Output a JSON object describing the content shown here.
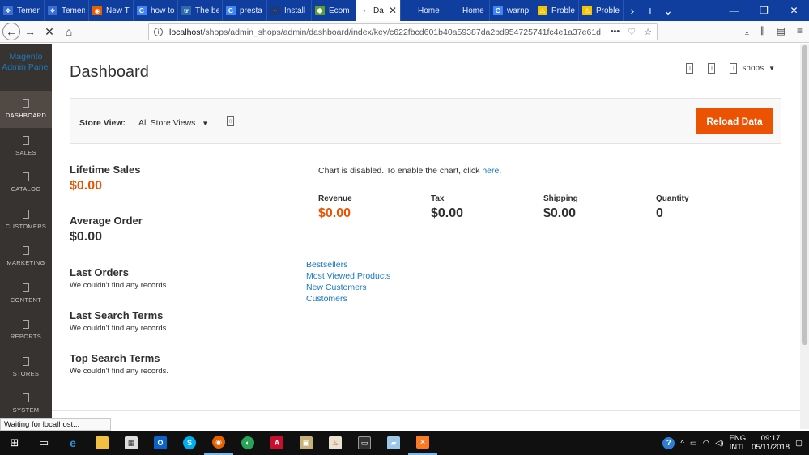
{
  "browser": {
    "tabs": [
      {
        "label": "Temen",
        "favicon_color": "#3b6fd1",
        "glyph": "❖"
      },
      {
        "label": "Temen",
        "favicon_color": "#3b6fd1",
        "glyph": "❖"
      },
      {
        "label": "New T",
        "favicon_color": "#e66000",
        "glyph": "◉"
      },
      {
        "label": "how to",
        "favicon_color": "#4285f4",
        "glyph": "G"
      },
      {
        "label": "The be",
        "favicon_color": "#2f6aa8",
        "glyph": "tr"
      },
      {
        "label": "presta",
        "favicon_color": "#4285f4",
        "glyph": "G"
      },
      {
        "label": "Install",
        "favicon_color": "#1b3b7a",
        "glyph": "~"
      },
      {
        "label": "Ecom",
        "favicon_color": "#5aa02c",
        "glyph": "⬢"
      },
      {
        "label": "Da",
        "favicon_color": "#ffffff",
        "glyph": "•",
        "active": true
      },
      {
        "label": "Home page",
        "favicon_color": "#0f3e9f",
        "glyph": ""
      },
      {
        "label": "Home page",
        "favicon_color": "#0f3e9f",
        "glyph": ""
      },
      {
        "label": "warnp",
        "favicon_color": "#4285f4",
        "glyph": "G"
      },
      {
        "label": "Proble",
        "favicon_color": "#f5c400",
        "glyph": "⚠"
      },
      {
        "label": "Proble",
        "favicon_color": "#f5c400",
        "glyph": "⚠"
      }
    ],
    "url_host": "localhost",
    "url_path": "/shops/admin_shops/admin/dashboard/index/key/c622fbcd601b40a59387da2bd954725741fc4e1a37e61d",
    "status_text": "Waiting for localhost..."
  },
  "sidebar": {
    "logo_line1": "Magento",
    "logo_line2": "Admin Panel",
    "items": [
      {
        "label": "DASHBOARD",
        "active": true
      },
      {
        "label": "SALES"
      },
      {
        "label": "CATALOG"
      },
      {
        "label": "CUSTOMERS"
      },
      {
        "label": "MARKETING"
      },
      {
        "label": "CONTENT"
      },
      {
        "label": "REPORTS"
      },
      {
        "label": "STORES"
      },
      {
        "label": "SYSTEM"
      }
    ]
  },
  "header": {
    "title": "Dashboard",
    "user": "shops"
  },
  "store_switcher": {
    "label": "Store View:",
    "value": "All Store Views",
    "reload_label": "Reload Data"
  },
  "stats": {
    "lifetime_sales_label": "Lifetime Sales",
    "lifetime_sales_value": "$0.00",
    "average_order_label": "Average Order",
    "average_order_value": "$0.00"
  },
  "chart": {
    "message": "Chart is disabled. To enable the chart, click ",
    "link": "here."
  },
  "totals": [
    {
      "label": "Revenue",
      "value": "$0.00",
      "accent": true
    },
    {
      "label": "Tax",
      "value": "$0.00"
    },
    {
      "label": "Shipping",
      "value": "$0.00"
    },
    {
      "label": "Quantity",
      "value": "0"
    }
  ],
  "grids": {
    "last_orders_title": "Last Orders",
    "last_orders_empty": "We couldn't find any records.",
    "last_search_title": "Last Search Terms",
    "last_search_empty": "We couldn't find any records.",
    "top_search_title": "Top Search Terms",
    "top_search_empty": "We couldn't find any records."
  },
  "dashboard_tabs": [
    "Bestsellers",
    "Most Viewed Products",
    "New Customers",
    "Customers"
  ],
  "taskbar": {
    "lang1": "ENG",
    "lang2": "INTL",
    "time": "09:17",
    "date": "05/11/2018"
  },
  "colors": {
    "accent": "#eb5202",
    "link": "#1979c3",
    "sidebar": "#373330"
  }
}
